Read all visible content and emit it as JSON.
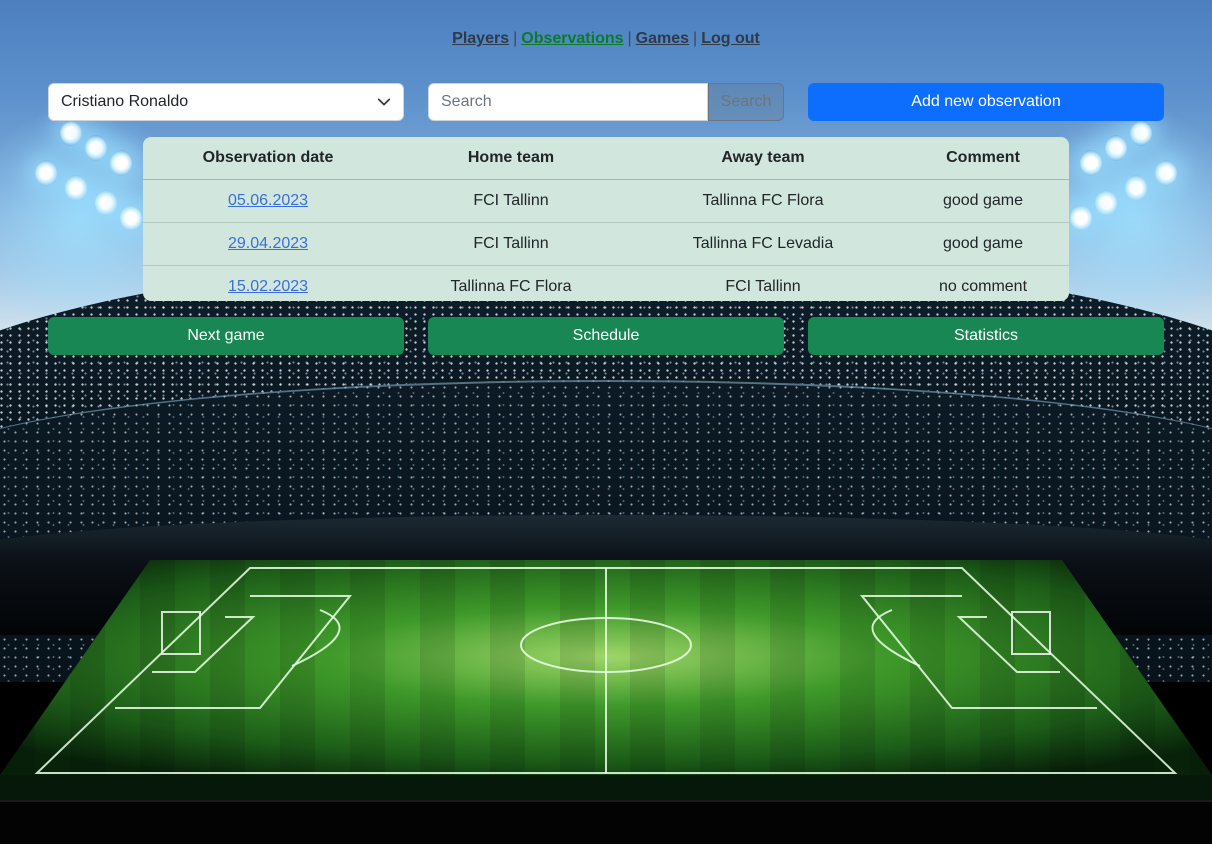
{
  "nav": {
    "items": [
      {
        "label": "Players"
      },
      {
        "label": "Observations"
      },
      {
        "label": "Games"
      },
      {
        "label": "Log out"
      }
    ],
    "separator": "|",
    "active_color": "#0b7a2a"
  },
  "player_select": {
    "selected": "Cristiano Ronaldo",
    "icon": "chevron-down-icon"
  },
  "search": {
    "placeholder": "Search",
    "button_label": "Search"
  },
  "add_button": {
    "label": "Add new observation",
    "color": "#0d6efd"
  },
  "table": {
    "headers": [
      "Observation date",
      "Home team",
      "Away team",
      "Comment"
    ],
    "rows": [
      {
        "date": "05.06.2023",
        "home": "FCI Tallinn",
        "away": "Tallinna FC Flora",
        "comment": "good game"
      },
      {
        "date": "29.04.2023",
        "home": "FCI Tallinn",
        "away": "Tallinna FC Levadia",
        "comment": "good game"
      },
      {
        "date": "15.02.2023",
        "home": "Tallinna FC Flora",
        "away": "FCI Tallinn",
        "comment": "no comment"
      }
    ],
    "background": "#d1e7dd"
  },
  "actions": {
    "next_game": "Next game",
    "schedule": "Schedule",
    "statistics": "Statistics",
    "color": "#198754"
  }
}
